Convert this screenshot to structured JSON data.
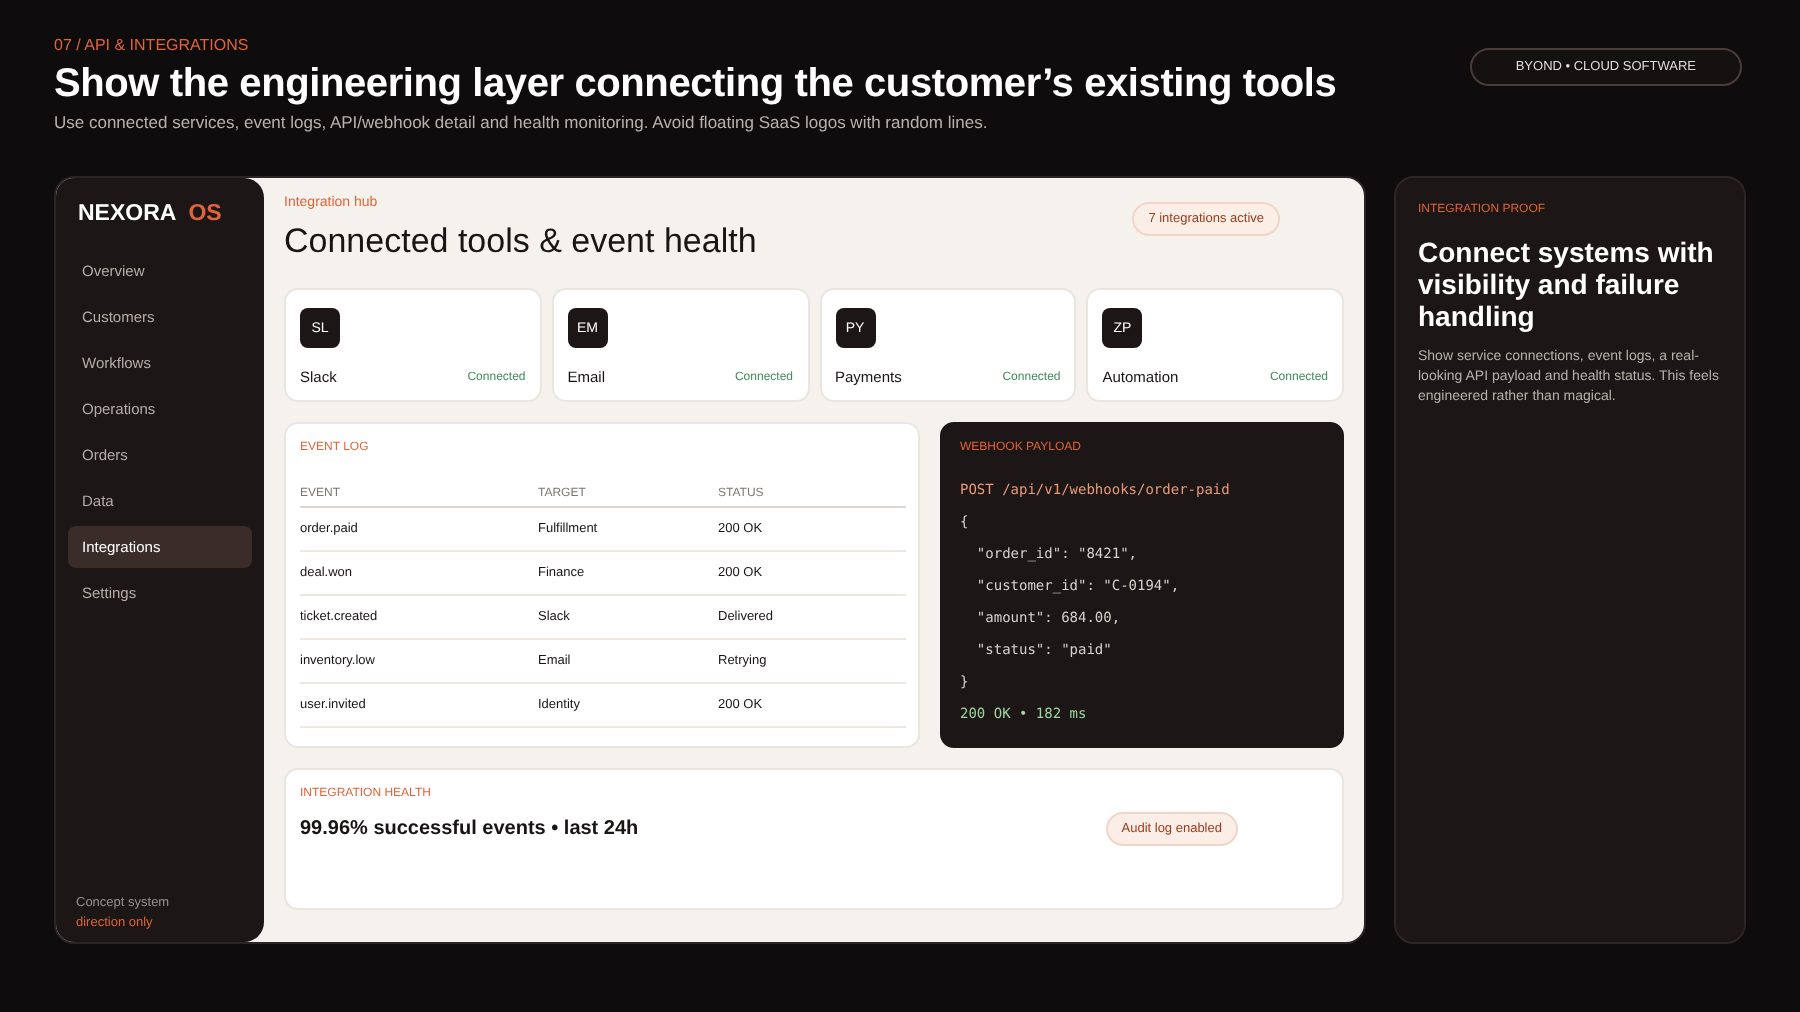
{
  "header": {
    "eyebrow": "07 / API & INTEGRATIONS",
    "title": "Show the engineering layer connecting the customer’s existing tools",
    "subtitle": "Use connected services, event logs, API/webhook detail and health monitoring. Avoid floating SaaS logos with random lines.",
    "badge": "BYOND • CLOUD SOFTWARE"
  },
  "sidebar": {
    "brand": "NEXORA",
    "brand_accent": "OS",
    "items": [
      {
        "label": "Overview",
        "selected": false
      },
      {
        "label": "Customers",
        "selected": false
      },
      {
        "label": "Workflows",
        "selected": false
      },
      {
        "label": "Operations",
        "selected": false
      },
      {
        "label": "Orders",
        "selected": false
      },
      {
        "label": "Data",
        "selected": false
      },
      {
        "label": "Integrations",
        "selected": true
      },
      {
        "label": "Settings",
        "selected": false
      }
    ],
    "footer": "Concept system",
    "footer_accent": "direction only"
  },
  "main": {
    "eyebrow": "Integration hub",
    "title": "Connected tools & event health",
    "pill": "7 integrations active",
    "tools": [
      {
        "initials": "SL",
        "name": "Slack",
        "status": "Connected"
      },
      {
        "initials": "EM",
        "name": "Email",
        "status": "Connected"
      },
      {
        "initials": "PY",
        "name": "Payments",
        "status": "Connected"
      },
      {
        "initials": "ZP",
        "name": "Automation",
        "status": "Connected"
      }
    ],
    "event_log": {
      "title": "EVENT LOG",
      "columns": [
        "EVENT",
        "TARGET",
        "STATUS"
      ],
      "rows": [
        [
          "order.paid",
          "Fulfillment",
          "200 OK"
        ],
        [
          "deal.won",
          "Finance",
          "200 OK"
        ],
        [
          "ticket.created",
          "Slack",
          "Delivered"
        ],
        [
          "inventory.low",
          "Email",
          "Retrying"
        ],
        [
          "user.invited",
          "Identity",
          "200 OK"
        ]
      ]
    },
    "webhook": {
      "title": "WEBHOOK PAYLOAD",
      "lines": [
        {
          "kind": "request",
          "text": "POST /api/v1/webhooks/order-paid"
        },
        {
          "kind": "code",
          "text": "{"
        },
        {
          "kind": "code",
          "text": "  \"order_id\": \"8421\","
        },
        {
          "kind": "code",
          "text": "  \"customer_id\": \"C-0194\","
        },
        {
          "kind": "code",
          "text": "  \"amount\": 684.00,"
        },
        {
          "kind": "code",
          "text": "  \"status\": \"paid\""
        },
        {
          "kind": "code",
          "text": "}"
        },
        {
          "kind": "result",
          "text": "200 OK • 182 ms"
        }
      ]
    },
    "health": {
      "title": "INTEGRATION HEALTH",
      "summary": "99.96% successful events • last 24h",
      "pill": "Audit log enabled"
    }
  },
  "proof": {
    "eyebrow": "INTEGRATION PROOF",
    "title": "Connect systems with visibility and failure handling",
    "body": "Show service connections, event logs, a real-looking API payload and health status. This feels engineered rather than magical."
  }
}
